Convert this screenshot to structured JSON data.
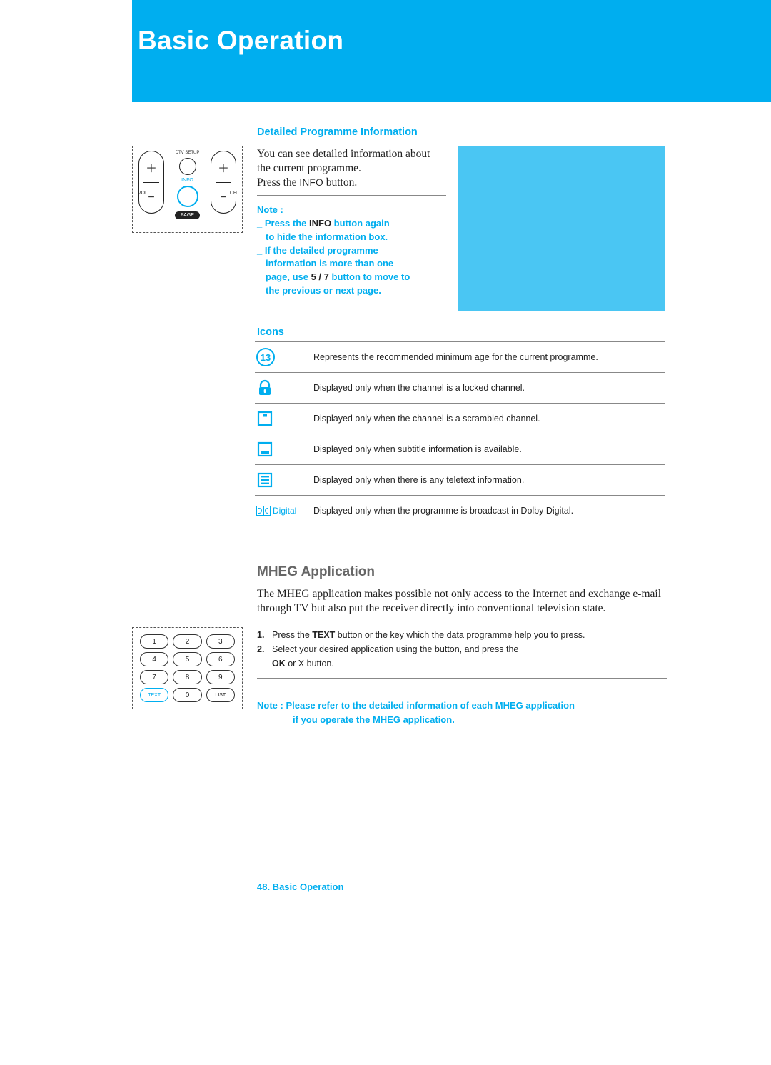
{
  "header": {
    "title": "Basic Operation"
  },
  "remote1": {
    "vol": "VOL",
    "ch": "CH",
    "dtv_setup": "DTV SETUP",
    "info": "INFO",
    "page": "PAGE"
  },
  "dpi": {
    "heading": "Detailed Programme Information",
    "line1": "You can see detailed information about the current programme.",
    "line2a": "Press the ",
    "line2b": "INFO",
    "line2c": "  button."
  },
  "note": {
    "label": "Note :",
    "l1a": "_ Press the ",
    "l1b": "INFO",
    "l1c": " button again",
    "l2": "to hide the information box.",
    "l3": "_ If the detailed programme",
    "l4": "information is more than one",
    "l5a": "page, use  ",
    "l5b": "5",
    "l5c": " / ",
    "l5d": "7",
    "l5e": " button to move to",
    "l6": "the previous or next page."
  },
  "icons": {
    "heading": "Icons",
    "rows": [
      {
        "desc": "Represents the recommended minimum age for the current programme."
      },
      {
        "desc": "Displayed only when the channel is a locked channel."
      },
      {
        "desc": "Displayed only when the channel is a scrambled channel."
      },
      {
        "desc": "Displayed only when subtitle information is available."
      },
      {
        "desc": "Displayed only when there is any teletext information."
      },
      {
        "desc": "Displayed only when the programme is broadcast in Dolby Digital."
      }
    ],
    "age": "13",
    "dolby_text": "Digital"
  },
  "mheg": {
    "title": "MHEG Application",
    "intro": "The MHEG application makes possible not only access to the Internet and exchange e-mail through TV but also put the receiver directly into conventional television state.",
    "step1_num": "1.",
    "step1a": "Press the ",
    "step1b": "TEXT",
    "step1c": " button or the key which the data programme help you to press.",
    "step2_num": "2.",
    "step2a": "Select your desired application using the button, and press the",
    "step2b": "OK",
    "step2c": " or  X  button.",
    "remote_keys": [
      [
        "1",
        "2",
        "3"
      ],
      [
        "4",
        "5",
        "6"
      ],
      [
        "7",
        "8",
        "9"
      ],
      [
        "TEXT",
        "0",
        "LIST"
      ]
    ],
    "note_label": "Note : ",
    "note_l1": "Please refer to the detailed information of each MHEG application",
    "note_l2": "if you operate the MHEG application."
  },
  "footer": {
    "text": "48. Basic Operation"
  }
}
